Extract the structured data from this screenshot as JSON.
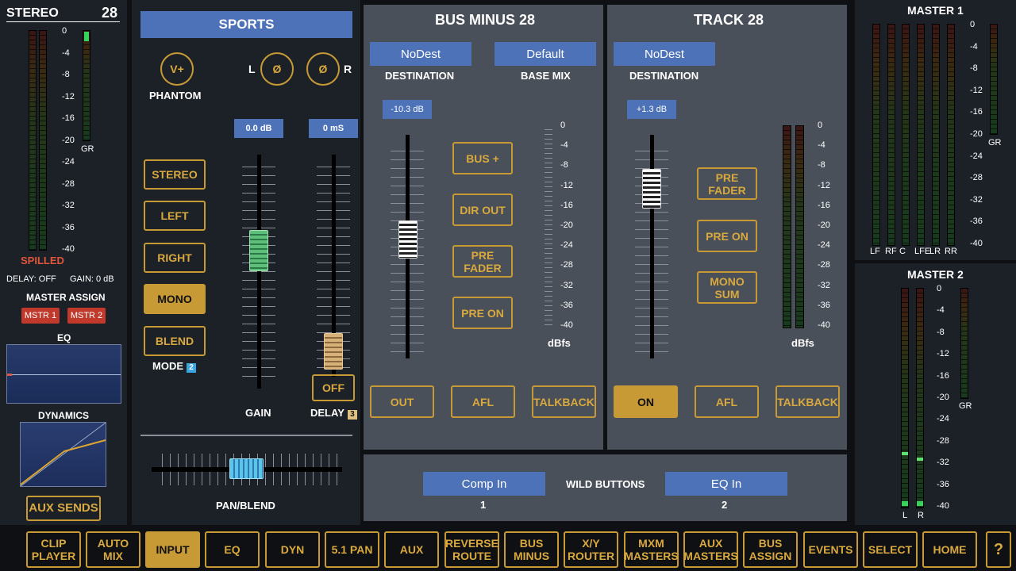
{
  "stereo": {
    "title": "STEREO",
    "channel": "28",
    "status": "SPILLED",
    "delay": "DELAY: OFF",
    "gain": "GAIN: 0 dB",
    "master_assign": "MASTER ASSIGN",
    "mstr1": "MSTR 1",
    "mstr2": "MSTR 2",
    "eq": "EQ",
    "dynamics": "DYNAMICS",
    "aux_sends": "AUX SENDS",
    "gr": "GR",
    "scale": [
      "0",
      "-4",
      "-8",
      "-12",
      "-16",
      "-20",
      "-24",
      "-28",
      "-32",
      "-36",
      "-40"
    ]
  },
  "input": {
    "name": "SPORTS",
    "phantom_btn": "V+",
    "phantom": "PHANTOM",
    "l": "L",
    "r": "R",
    "phase_l": "Ø",
    "phase_r": "Ø",
    "gain_value": "0.0 dB",
    "delay_value": "0 mS",
    "modes": [
      "STEREO",
      "LEFT",
      "RIGHT",
      "MONO",
      "BLEND"
    ],
    "mode_label": "MODE",
    "mode_badge": "2",
    "gain_label": "GAIN",
    "delay_label": "DELAY",
    "delay_badge": "3",
    "delay_off": "OFF",
    "pan_label": "PAN/BLEND"
  },
  "bus_minus": {
    "title": "BUS MINUS 28",
    "dest": "NoDest",
    "dest_label": "DESTINATION",
    "base": "Default",
    "base_label": "BASE MIX",
    "fader_value": "-10.3 dB",
    "buttons": [
      "BUS +",
      "DIR OUT",
      "PRE FADER",
      "PRE ON"
    ],
    "dbfs": "dBfs",
    "bottom": [
      "OUT",
      "AFL",
      "TALKBACK"
    ]
  },
  "track": {
    "title": "TRACK 28",
    "dest": "NoDest",
    "dest_label": "DESTINATION",
    "fader_value": "+1.3 dB",
    "buttons": [
      "PRE FADER",
      "PRE ON",
      "MONO SUM"
    ],
    "dbfs": "dBfs",
    "bottom": [
      "ON",
      "AFL",
      "TALKBACK"
    ]
  },
  "wild": {
    "label": "WILD BUTTONS",
    "btn1": "Comp In",
    "num1": "1",
    "btn2": "EQ In",
    "num2": "2"
  },
  "master1": {
    "title": "MASTER 1",
    "channels": [
      "LF",
      "RF",
      "C",
      "LFE",
      "LR",
      "RR"
    ],
    "gr": "GR"
  },
  "master2": {
    "title": "MASTER 2",
    "channels": [
      "L",
      "R"
    ],
    "gr": "GR"
  },
  "nav": [
    "CLIP PLAYER",
    "AUTO MIX",
    "INPUT",
    "EQ",
    "DYN",
    "5.1 PAN",
    "AUX",
    "REVERSE ROUTE",
    "BUS MINUS",
    "X/Y ROUTER",
    "MXM MASTERS",
    "AUX MASTERS",
    "BUS ASSIGN",
    "EVENTS",
    "SELECT",
    "HOME",
    "?"
  ],
  "colors": {
    "accent": "#c89a36",
    "blue": "#4d72b8",
    "red": "#c0392b",
    "spilled": "#e0553b"
  }
}
